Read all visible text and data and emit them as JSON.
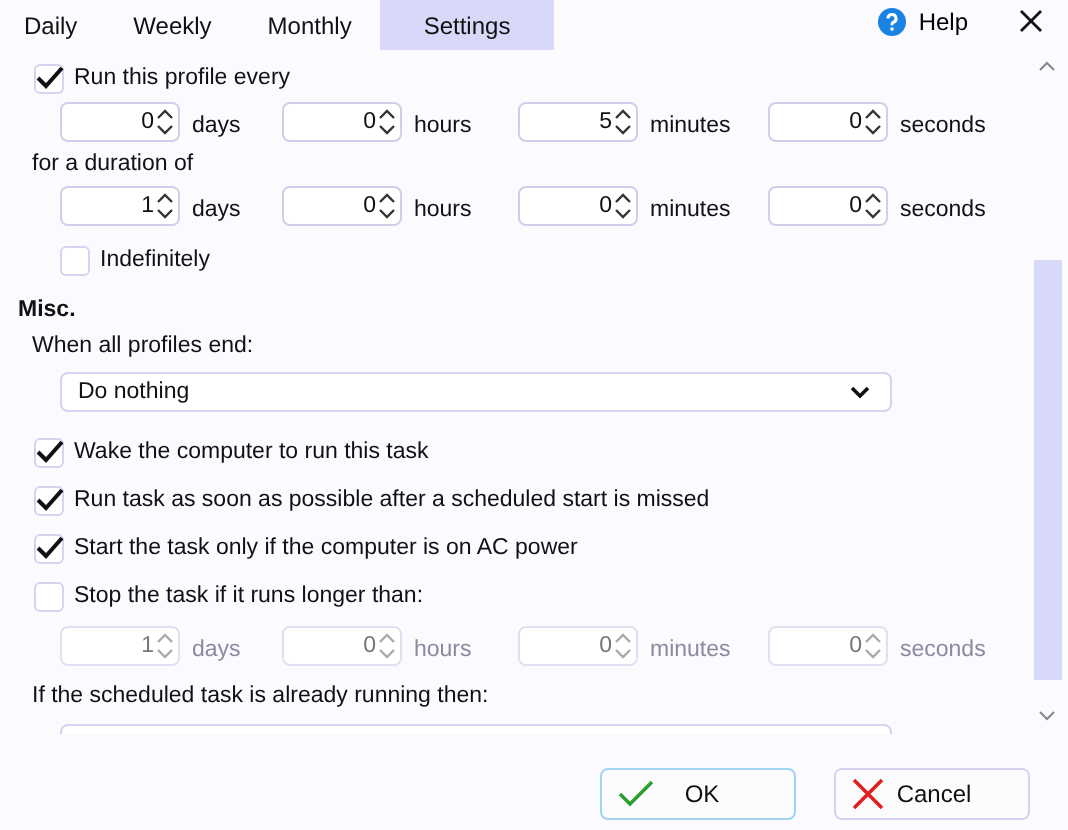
{
  "tabs": [
    {
      "label": "Daily",
      "selected": false
    },
    {
      "label": "Weekly",
      "selected": false
    },
    {
      "label": "Monthly",
      "selected": false
    },
    {
      "label": "Settings",
      "selected": true
    }
  ],
  "help": {
    "label": "Help"
  },
  "repeat": {
    "label": "Run this profile every",
    "checked": true,
    "interval": [
      {
        "value": "0",
        "unit": "days"
      },
      {
        "value": "0",
        "unit": "hours"
      },
      {
        "value": "5",
        "unit": "minutes"
      },
      {
        "value": "0",
        "unit": "seconds"
      }
    ],
    "duration_label": "for a duration of",
    "duration": [
      {
        "value": "1",
        "unit": "days"
      },
      {
        "value": "0",
        "unit": "hours"
      },
      {
        "value": "0",
        "unit": "minutes"
      },
      {
        "value": "0",
        "unit": "seconds"
      }
    ],
    "indefinitely": {
      "label": "Indefinitely",
      "checked": false
    }
  },
  "misc": {
    "title": "Misc.",
    "end_label": "When all profiles end:",
    "end_action": "Do nothing",
    "options": [
      {
        "label": "Wake the computer to run this task",
        "checked": true
      },
      {
        "label": "Run task as soon as possible after a scheduled start is missed",
        "checked": true
      },
      {
        "label": "Start the task only if the computer is on AC power",
        "checked": true
      },
      {
        "label": "Stop the task if it runs longer than:",
        "checked": false
      }
    ],
    "stop_after": {
      "disabled": true,
      "fields": [
        {
          "value": "1",
          "unit": "days"
        },
        {
          "value": "0",
          "unit": "hours"
        },
        {
          "value": "0",
          "unit": "minutes"
        },
        {
          "value": "0",
          "unit": "seconds"
        }
      ]
    },
    "running_label": "If the scheduled task is already running then:"
  },
  "buttons": [
    {
      "label": "OK",
      "kind": "ok"
    },
    {
      "label": "Cancel",
      "kind": "cancel"
    }
  ]
}
